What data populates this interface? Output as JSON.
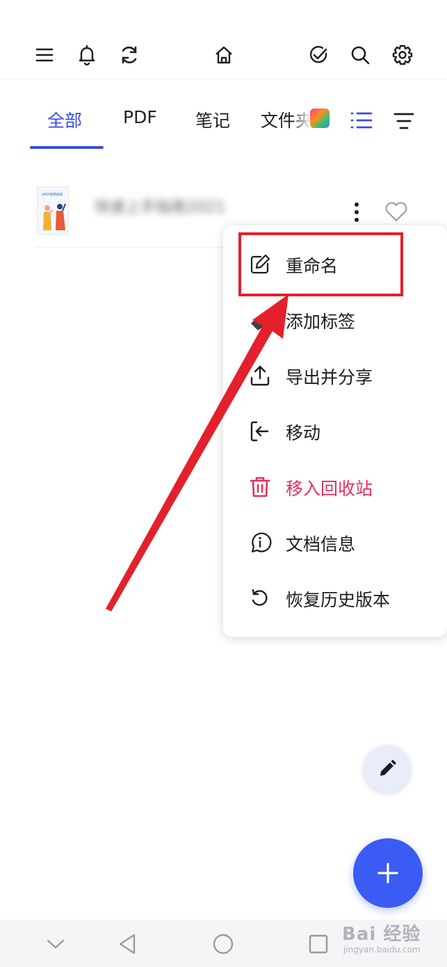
{
  "tabs": [
    {
      "label": "全部",
      "active": true
    },
    {
      "label": "PDF",
      "active": false
    },
    {
      "label": "笔记",
      "active": false
    },
    {
      "label": "文件夹",
      "active": false
    }
  ],
  "document": {
    "title": "快速上手指南2021",
    "thumb_caption": "UPDF使用指南"
  },
  "menu": {
    "items": [
      {
        "label": "重命名",
        "icon": "edit-icon",
        "highlighted": true
      },
      {
        "label": "添加标签",
        "icon": "tag-icon"
      },
      {
        "label": "导出并分享",
        "icon": "share-icon"
      },
      {
        "label": "移动",
        "icon": "move-icon"
      },
      {
        "label": "移入回收站",
        "icon": "trash-icon",
        "danger": true
      },
      {
        "label": "文档信息",
        "icon": "info-icon"
      },
      {
        "label": "恢复历史版本",
        "icon": "history-icon"
      }
    ]
  },
  "watermark": {
    "main": "Bai 经验",
    "sub": "jingyan.baidu.com"
  },
  "colors": {
    "accent": "#3b4ae6",
    "danger": "#e8305c",
    "highlight": "#e3202b",
    "fab": "#3b5bf5"
  }
}
